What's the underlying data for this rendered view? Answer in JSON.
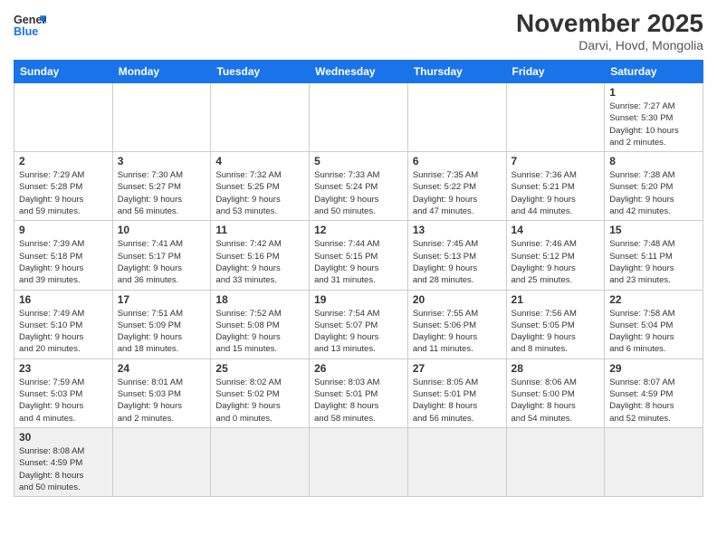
{
  "header": {
    "logo_general": "General",
    "logo_blue": "Blue",
    "month_year": "November 2025",
    "location": "Darvi, Hovd, Mongolia"
  },
  "weekdays": [
    "Sunday",
    "Monday",
    "Tuesday",
    "Wednesday",
    "Thursday",
    "Friday",
    "Saturday"
  ],
  "weeks": [
    [
      {
        "day": "",
        "info": ""
      },
      {
        "day": "",
        "info": ""
      },
      {
        "day": "",
        "info": ""
      },
      {
        "day": "",
        "info": ""
      },
      {
        "day": "",
        "info": ""
      },
      {
        "day": "",
        "info": ""
      },
      {
        "day": "1",
        "info": "Sunrise: 7:27 AM\nSunset: 5:30 PM\nDaylight: 10 hours\nand 2 minutes."
      }
    ],
    [
      {
        "day": "2",
        "info": "Sunrise: 7:29 AM\nSunset: 5:28 PM\nDaylight: 9 hours\nand 59 minutes."
      },
      {
        "day": "3",
        "info": "Sunrise: 7:30 AM\nSunset: 5:27 PM\nDaylight: 9 hours\nand 56 minutes."
      },
      {
        "day": "4",
        "info": "Sunrise: 7:32 AM\nSunset: 5:25 PM\nDaylight: 9 hours\nand 53 minutes."
      },
      {
        "day": "5",
        "info": "Sunrise: 7:33 AM\nSunset: 5:24 PM\nDaylight: 9 hours\nand 50 minutes."
      },
      {
        "day": "6",
        "info": "Sunrise: 7:35 AM\nSunset: 5:22 PM\nDaylight: 9 hours\nand 47 minutes."
      },
      {
        "day": "7",
        "info": "Sunrise: 7:36 AM\nSunset: 5:21 PM\nDaylight: 9 hours\nand 44 minutes."
      },
      {
        "day": "8",
        "info": "Sunrise: 7:38 AM\nSunset: 5:20 PM\nDaylight: 9 hours\nand 42 minutes."
      }
    ],
    [
      {
        "day": "9",
        "info": "Sunrise: 7:39 AM\nSunset: 5:18 PM\nDaylight: 9 hours\nand 39 minutes."
      },
      {
        "day": "10",
        "info": "Sunrise: 7:41 AM\nSunset: 5:17 PM\nDaylight: 9 hours\nand 36 minutes."
      },
      {
        "day": "11",
        "info": "Sunrise: 7:42 AM\nSunset: 5:16 PM\nDaylight: 9 hours\nand 33 minutes."
      },
      {
        "day": "12",
        "info": "Sunrise: 7:44 AM\nSunset: 5:15 PM\nDaylight: 9 hours\nand 31 minutes."
      },
      {
        "day": "13",
        "info": "Sunrise: 7:45 AM\nSunset: 5:13 PM\nDaylight: 9 hours\nand 28 minutes."
      },
      {
        "day": "14",
        "info": "Sunrise: 7:46 AM\nSunset: 5:12 PM\nDaylight: 9 hours\nand 25 minutes."
      },
      {
        "day": "15",
        "info": "Sunrise: 7:48 AM\nSunset: 5:11 PM\nDaylight: 9 hours\nand 23 minutes."
      }
    ],
    [
      {
        "day": "16",
        "info": "Sunrise: 7:49 AM\nSunset: 5:10 PM\nDaylight: 9 hours\nand 20 minutes."
      },
      {
        "day": "17",
        "info": "Sunrise: 7:51 AM\nSunset: 5:09 PM\nDaylight: 9 hours\nand 18 minutes."
      },
      {
        "day": "18",
        "info": "Sunrise: 7:52 AM\nSunset: 5:08 PM\nDaylight: 9 hours\nand 15 minutes."
      },
      {
        "day": "19",
        "info": "Sunrise: 7:54 AM\nSunset: 5:07 PM\nDaylight: 9 hours\nand 13 minutes."
      },
      {
        "day": "20",
        "info": "Sunrise: 7:55 AM\nSunset: 5:06 PM\nDaylight: 9 hours\nand 11 minutes."
      },
      {
        "day": "21",
        "info": "Sunrise: 7:56 AM\nSunset: 5:05 PM\nDaylight: 9 hours\nand 8 minutes."
      },
      {
        "day": "22",
        "info": "Sunrise: 7:58 AM\nSunset: 5:04 PM\nDaylight: 9 hours\nand 6 minutes."
      }
    ],
    [
      {
        "day": "23",
        "info": "Sunrise: 7:59 AM\nSunset: 5:03 PM\nDaylight: 9 hours\nand 4 minutes."
      },
      {
        "day": "24",
        "info": "Sunrise: 8:01 AM\nSunset: 5:03 PM\nDaylight: 9 hours\nand 2 minutes."
      },
      {
        "day": "25",
        "info": "Sunrise: 8:02 AM\nSunset: 5:02 PM\nDaylight: 9 hours\nand 0 minutes."
      },
      {
        "day": "26",
        "info": "Sunrise: 8:03 AM\nSunset: 5:01 PM\nDaylight: 8 hours\nand 58 minutes."
      },
      {
        "day": "27",
        "info": "Sunrise: 8:05 AM\nSunset: 5:01 PM\nDaylight: 8 hours\nand 56 minutes."
      },
      {
        "day": "28",
        "info": "Sunrise: 8:06 AM\nSunset: 5:00 PM\nDaylight: 8 hours\nand 54 minutes."
      },
      {
        "day": "29",
        "info": "Sunrise: 8:07 AM\nSunset: 4:59 PM\nDaylight: 8 hours\nand 52 minutes."
      }
    ],
    [
      {
        "day": "30",
        "info": "Sunrise: 8:08 AM\nSunset: 4:59 PM\nDaylight: 8 hours\nand 50 minutes."
      },
      {
        "day": "",
        "info": ""
      },
      {
        "day": "",
        "info": ""
      },
      {
        "day": "",
        "info": ""
      },
      {
        "day": "",
        "info": ""
      },
      {
        "day": "",
        "info": ""
      },
      {
        "day": "",
        "info": ""
      }
    ]
  ]
}
